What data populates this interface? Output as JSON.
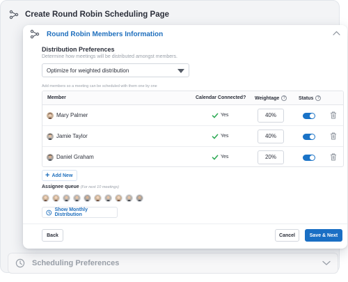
{
  "outer": {
    "title": "Create Round Robin Scheduling Page"
  },
  "modal": {
    "title": "Round Robin Members Information",
    "distribution": {
      "title": "Distribution Preferences",
      "description": "Determine how meetings will be distributed amongst members.",
      "selected": "Optimize for weighted distribution"
    },
    "add_hint": "Add members so a meeting can be scheduled with them one by one",
    "table": {
      "headers": {
        "member": "Member",
        "calendar": "Calendar Connected?",
        "weightage": "Weightage",
        "status": "Status"
      },
      "rows": [
        {
          "name": "Mary Palmer",
          "calendar": "Yes",
          "weight": "40%"
        },
        {
          "name": "Jamie Taylor",
          "calendar": "Yes",
          "weight": "40%"
        },
        {
          "name": "Daniel Graham",
          "calendar": "Yes",
          "weight": "20%"
        }
      ]
    },
    "add_new_label": "Add New",
    "queue": {
      "label": "Assignee queue",
      "note": "(For next 10 meetings)"
    },
    "show_monthly_label": "Show Monthly Distribution",
    "buttons": {
      "back": "Back",
      "cancel": "Cancel",
      "save_next": "Save & Next"
    }
  },
  "scheduling_section": {
    "title": "Scheduling Preferences"
  },
  "colors": {
    "accent": "#1f6fbd",
    "primary_button": "#1a6fc4",
    "check_green": "#2eaa55"
  }
}
